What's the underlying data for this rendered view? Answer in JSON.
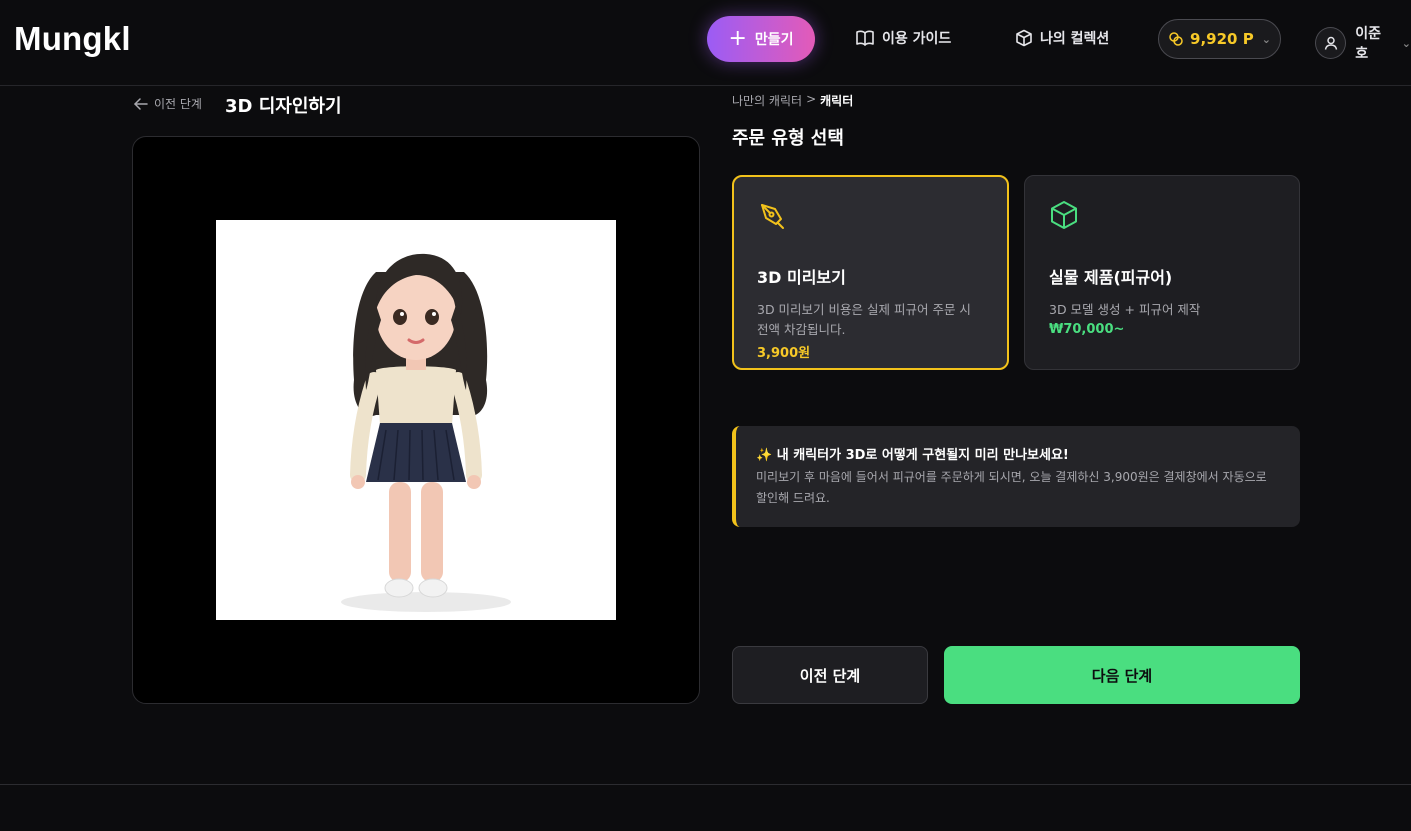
{
  "header": {
    "logo": "Mungkl",
    "create_label": "만들기",
    "guide_label": "이용 가이드",
    "collection_label": "나의 컬렉션",
    "points": "9,920 P",
    "user_name": "이준호"
  },
  "left": {
    "back_label": "이전 단계",
    "title": "3D 디자인하기"
  },
  "breadcrumb": {
    "parent": "나만의 캐릭터",
    "separator": ">",
    "current": "캐릭터"
  },
  "order": {
    "section_title": "주문 유형 선택",
    "options": [
      {
        "title": "3D 미리보기",
        "desc": "3D 미리보기 비용은 실제 피규어 주문 시 전액 차감됩니다.",
        "price": "3,900원",
        "selected": true,
        "icon": "pen-nib-icon"
      },
      {
        "title": "실물 제품(피규어)",
        "desc": "3D 모델 생성 + 피규어 제작",
        "price": "₩70,000~",
        "selected": false,
        "icon": "cube-icon"
      }
    ]
  },
  "notice": {
    "title": "✨ 내 캐릭터가 3D로 어떻게 구현될지 미리 만나보세요!",
    "body": "미리보기 후 마음에 들어서 피규어를 주문하게 되시면, 오늘 결제하신 3,900원은 결제창에서 자동으로 할인해 드려요."
  },
  "actions": {
    "prev_label": "이전 단계",
    "next_label": "다음 단계"
  },
  "colors": {
    "accent_yellow": "#f2c21b",
    "accent_green": "#4ade80",
    "create_gradient_start": "#9b5cf5",
    "create_gradient_end": "#e35bb8"
  }
}
